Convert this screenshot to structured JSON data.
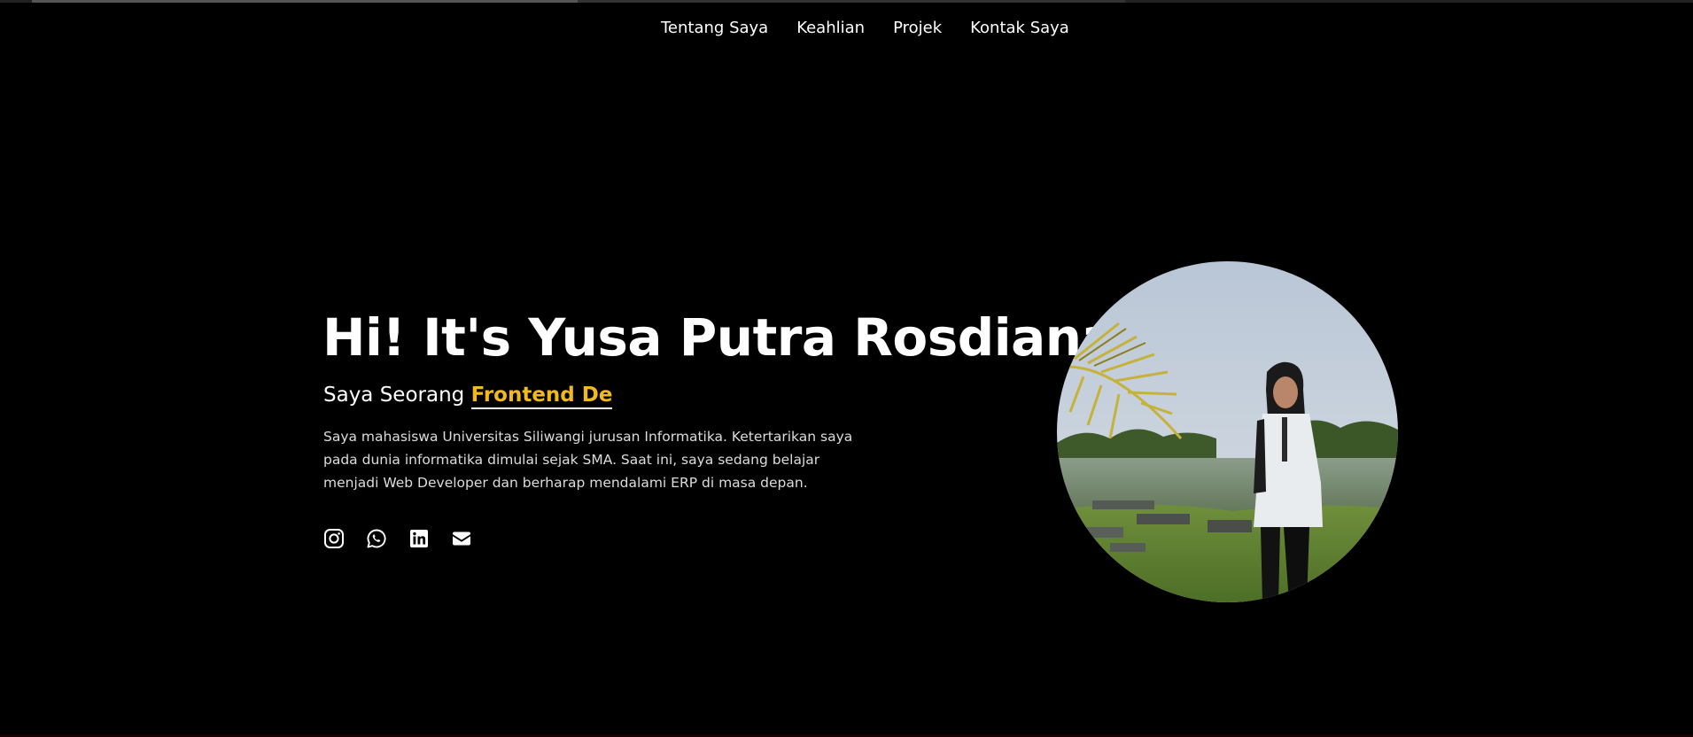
{
  "nav": {
    "items": [
      {
        "label": "Tentang Saya"
      },
      {
        "label": "Keahlian"
      },
      {
        "label": "Projek"
      },
      {
        "label": "Kontak Saya"
      }
    ]
  },
  "hero": {
    "title": "Hi! It's Yusa Putra Rosdiana",
    "subtitle_prefix": "Saya Seorang",
    "subtitle_typed": "Frontend De",
    "description": "Saya mahasiswa Universitas Siliwangi jurusan Informatika. Ketertarikan saya pada dunia informatika dimulai sejak SMA. Saat ini, saya sedang belajar menjadi Web Developer dan berharap mendalami ERP di masa depan.",
    "accent_color": "#f2b81f"
  },
  "socials": [
    {
      "icon": "instagram-icon"
    },
    {
      "icon": "whatsapp-icon"
    },
    {
      "icon": "linkedin-icon"
    },
    {
      "icon": "envelope-icon"
    }
  ],
  "colors": {
    "background": "#000000",
    "text": "#ffffff",
    "accent": "#f2b81f"
  }
}
